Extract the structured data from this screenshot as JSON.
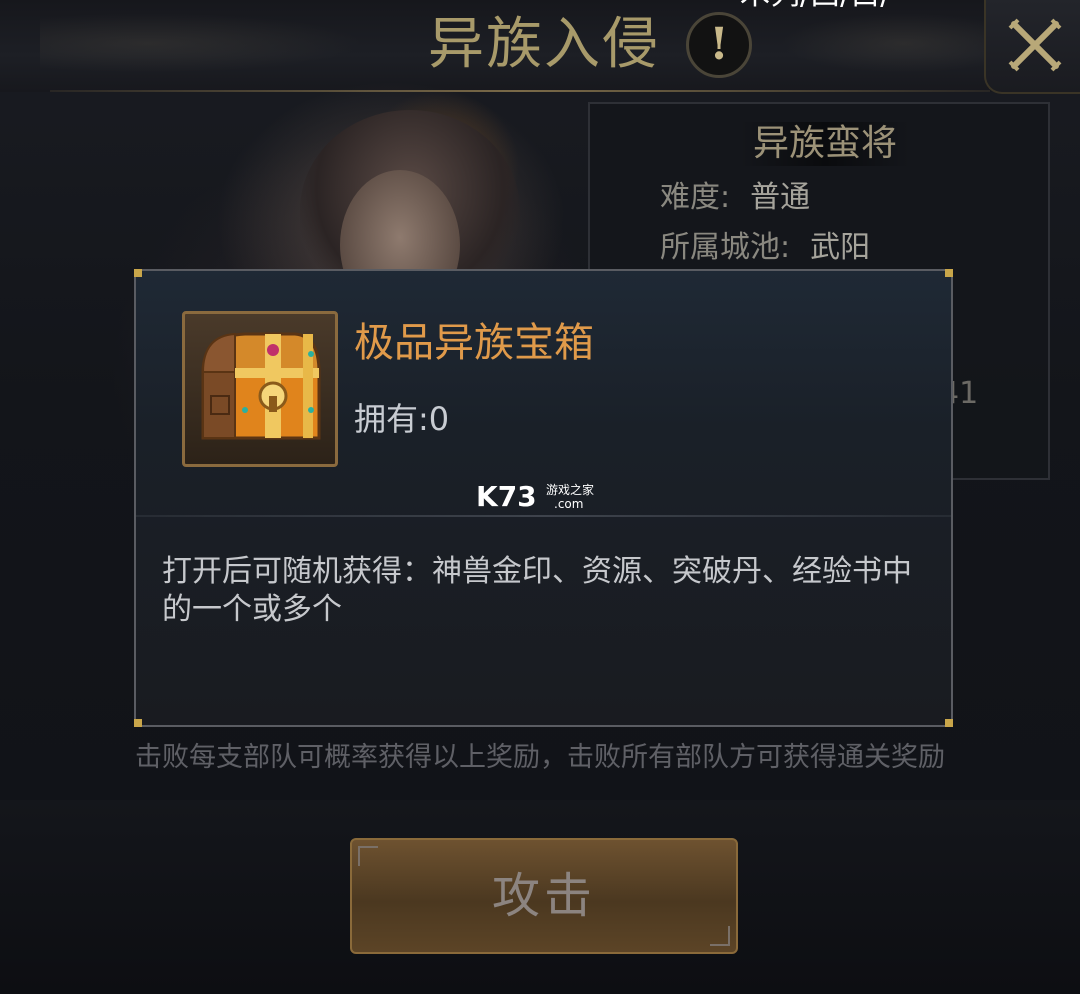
{
  "header": {
    "title": "异族入侵",
    "info_symbol": "!",
    "top_clip_text": "木列/囗/白/"
  },
  "enemy_panel": {
    "name": "异族蛮将",
    "difficulty_label": "难度:",
    "difficulty_value": "普通",
    "city_label": "所属城池:",
    "city_value": "武阳",
    "partial_number": "41"
  },
  "tooltip": {
    "item_name": "极品异族宝箱",
    "owned_label": "拥有:",
    "owned_value": "0",
    "description": "打开后可随机获得：神兽金印、资源、突破丹、经验书中的一个或多个",
    "watermark_main": "K73",
    "watermark_sub": "游戏之家",
    "watermark_domain": ".com",
    "icon": "treasure-chest-icon"
  },
  "reward_note": "击败每支部队可概率获得以上奖励，击败所有部队方可获得通关奖励",
  "attack_button": {
    "label": "攻击"
  },
  "colors": {
    "title": "#a89a6a",
    "item_name": "#e09a4a",
    "button": "#6e5230"
  }
}
